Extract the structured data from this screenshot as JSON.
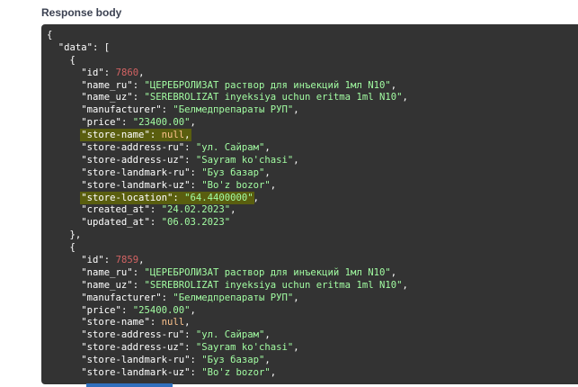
{
  "section": {
    "title": "Response body"
  },
  "colors": {
    "panel_bg": "#333333",
    "key": "#ffffff",
    "string": "#a2fca2",
    "number": "#d36363",
    "literal": "#fcc28c",
    "highlight": "#5a5e0f"
  },
  "code_lines": [
    [
      {
        "t": "p",
        "v": "{"
      }
    ],
    [
      {
        "t": "p",
        "v": "  "
      },
      {
        "t": "k",
        "v": "\"data\""
      },
      {
        "t": "p",
        "v": ": ["
      }
    ],
    [
      {
        "t": "p",
        "v": "    {"
      }
    ],
    [
      {
        "t": "p",
        "v": "      "
      },
      {
        "t": "k",
        "v": "\"id\""
      },
      {
        "t": "p",
        "v": ": "
      },
      {
        "t": "n",
        "v": "7860"
      },
      {
        "t": "p",
        "v": ","
      }
    ],
    [
      {
        "t": "p",
        "v": "      "
      },
      {
        "t": "k",
        "v": "\"name_ru\""
      },
      {
        "t": "p",
        "v": ": "
      },
      {
        "t": "s",
        "v": "\"ЦЕРЕБРОЛИЗАТ раствор для инъекций 1мл N10\""
      },
      {
        "t": "p",
        "v": ","
      }
    ],
    [
      {
        "t": "p",
        "v": "      "
      },
      {
        "t": "k",
        "v": "\"name_uz\""
      },
      {
        "t": "p",
        "v": ": "
      },
      {
        "t": "s",
        "v": "\"SEREBROLIZAT inyeksiya uchun eritma 1ml N10\""
      },
      {
        "t": "p",
        "v": ","
      }
    ],
    [
      {
        "t": "p",
        "v": "      "
      },
      {
        "t": "k",
        "v": "\"manufacturer\""
      },
      {
        "t": "p",
        "v": ": "
      },
      {
        "t": "s",
        "v": "\"Белмедпрепараты РУП\""
      },
      {
        "t": "p",
        "v": ","
      }
    ],
    [
      {
        "t": "p",
        "v": "      "
      },
      {
        "t": "k",
        "v": "\"price\""
      },
      {
        "t": "p",
        "v": ": "
      },
      {
        "t": "s",
        "v": "\"23400.00\""
      },
      {
        "t": "p",
        "v": ","
      }
    ],
    [
      {
        "t": "p",
        "v": "      "
      },
      {
        "t": "k",
        "v": "\"store-name\"",
        "h": true
      },
      {
        "t": "p",
        "v": ": ",
        "h": true
      },
      {
        "t": "l",
        "v": "null",
        "h": true
      },
      {
        "t": "p",
        "v": ",",
        "h": true
      }
    ],
    [
      {
        "t": "p",
        "v": "      "
      },
      {
        "t": "k",
        "v": "\"store-address-ru\""
      },
      {
        "t": "p",
        "v": ": "
      },
      {
        "t": "s",
        "v": "\"ул. Сайрам\""
      },
      {
        "t": "p",
        "v": ","
      }
    ],
    [
      {
        "t": "p",
        "v": "      "
      },
      {
        "t": "k",
        "v": "\"store-address-uz\""
      },
      {
        "t": "p",
        "v": ": "
      },
      {
        "t": "s",
        "v": "\"Sayram ko'chasi\""
      },
      {
        "t": "p",
        "v": ","
      }
    ],
    [
      {
        "t": "p",
        "v": "      "
      },
      {
        "t": "k",
        "v": "\"store-landmark-ru\""
      },
      {
        "t": "p",
        "v": ": "
      },
      {
        "t": "s",
        "v": "\"Буз базар\""
      },
      {
        "t": "p",
        "v": ","
      }
    ],
    [
      {
        "t": "p",
        "v": "      "
      },
      {
        "t": "k",
        "v": "\"store-landmark-uz\""
      },
      {
        "t": "p",
        "v": ": "
      },
      {
        "t": "s",
        "v": "\"Bo'z bozor\""
      },
      {
        "t": "p",
        "v": ","
      }
    ],
    [
      {
        "t": "p",
        "v": "      "
      },
      {
        "t": "k",
        "v": "\"store-location\"",
        "h": true
      },
      {
        "t": "p",
        "v": ": ",
        "h": true
      },
      {
        "t": "s",
        "v": "\"64.4400000\"",
        "h": true
      },
      {
        "t": "p",
        "v": ","
      }
    ],
    [
      {
        "t": "p",
        "v": "      "
      },
      {
        "t": "k",
        "v": "\"created_at\""
      },
      {
        "t": "p",
        "v": ": "
      },
      {
        "t": "s",
        "v": "\"24.02.2023\""
      },
      {
        "t": "p",
        "v": ","
      }
    ],
    [
      {
        "t": "p",
        "v": "      "
      },
      {
        "t": "k",
        "v": "\"updated_at\""
      },
      {
        "t": "p",
        "v": ": "
      },
      {
        "t": "s",
        "v": "\"06.03.2023\""
      }
    ],
    [
      {
        "t": "p",
        "v": "    },"
      }
    ],
    [
      {
        "t": "p",
        "v": "    {"
      }
    ],
    [
      {
        "t": "p",
        "v": "      "
      },
      {
        "t": "k",
        "v": "\"id\""
      },
      {
        "t": "p",
        "v": ": "
      },
      {
        "t": "n",
        "v": "7859"
      },
      {
        "t": "p",
        "v": ","
      }
    ],
    [
      {
        "t": "p",
        "v": "      "
      },
      {
        "t": "k",
        "v": "\"name_ru\""
      },
      {
        "t": "p",
        "v": ": "
      },
      {
        "t": "s",
        "v": "\"ЦЕРЕБРОЛИЗАТ раствор для инъекций 1мл N10\""
      },
      {
        "t": "p",
        "v": ","
      }
    ],
    [
      {
        "t": "p",
        "v": "      "
      },
      {
        "t": "k",
        "v": "\"name_uz\""
      },
      {
        "t": "p",
        "v": ": "
      },
      {
        "t": "s",
        "v": "\"SEREBROLIZAT inyeksiya uchun eritma 1ml N10\""
      },
      {
        "t": "p",
        "v": ","
      }
    ],
    [
      {
        "t": "p",
        "v": "      "
      },
      {
        "t": "k",
        "v": "\"manufacturer\""
      },
      {
        "t": "p",
        "v": ": "
      },
      {
        "t": "s",
        "v": "\"Белмедпрепараты РУП\""
      },
      {
        "t": "p",
        "v": ","
      }
    ],
    [
      {
        "t": "p",
        "v": "      "
      },
      {
        "t": "k",
        "v": "\"price\""
      },
      {
        "t": "p",
        "v": ": "
      },
      {
        "t": "s",
        "v": "\"25400.00\""
      },
      {
        "t": "p",
        "v": ","
      }
    ],
    [
      {
        "t": "p",
        "v": "      "
      },
      {
        "t": "k",
        "v": "\"store-name\""
      },
      {
        "t": "p",
        "v": ": "
      },
      {
        "t": "l",
        "v": "null"
      },
      {
        "t": "p",
        "v": ","
      }
    ],
    [
      {
        "t": "p",
        "v": "      "
      },
      {
        "t": "k",
        "v": "\"store-address-ru\""
      },
      {
        "t": "p",
        "v": ": "
      },
      {
        "t": "s",
        "v": "\"ул. Сайрам\""
      },
      {
        "t": "p",
        "v": ","
      }
    ],
    [
      {
        "t": "p",
        "v": "      "
      },
      {
        "t": "k",
        "v": "\"store-address-uz\""
      },
      {
        "t": "p",
        "v": ": "
      },
      {
        "t": "s",
        "v": "\"Sayram ko'chasi\""
      },
      {
        "t": "p",
        "v": ","
      }
    ],
    [
      {
        "t": "p",
        "v": "      "
      },
      {
        "t": "k",
        "v": "\"store-landmark-ru\""
      },
      {
        "t": "p",
        "v": ": "
      },
      {
        "t": "s",
        "v": "\"Буз базар\""
      },
      {
        "t": "p",
        "v": ","
      }
    ],
    [
      {
        "t": "p",
        "v": "      "
      },
      {
        "t": "k",
        "v": "\"store-landmark-uz\""
      },
      {
        "t": "p",
        "v": ": "
      },
      {
        "t": "s",
        "v": "\"Bo'z bozor\""
      },
      {
        "t": "p",
        "v": ","
      }
    ]
  ]
}
